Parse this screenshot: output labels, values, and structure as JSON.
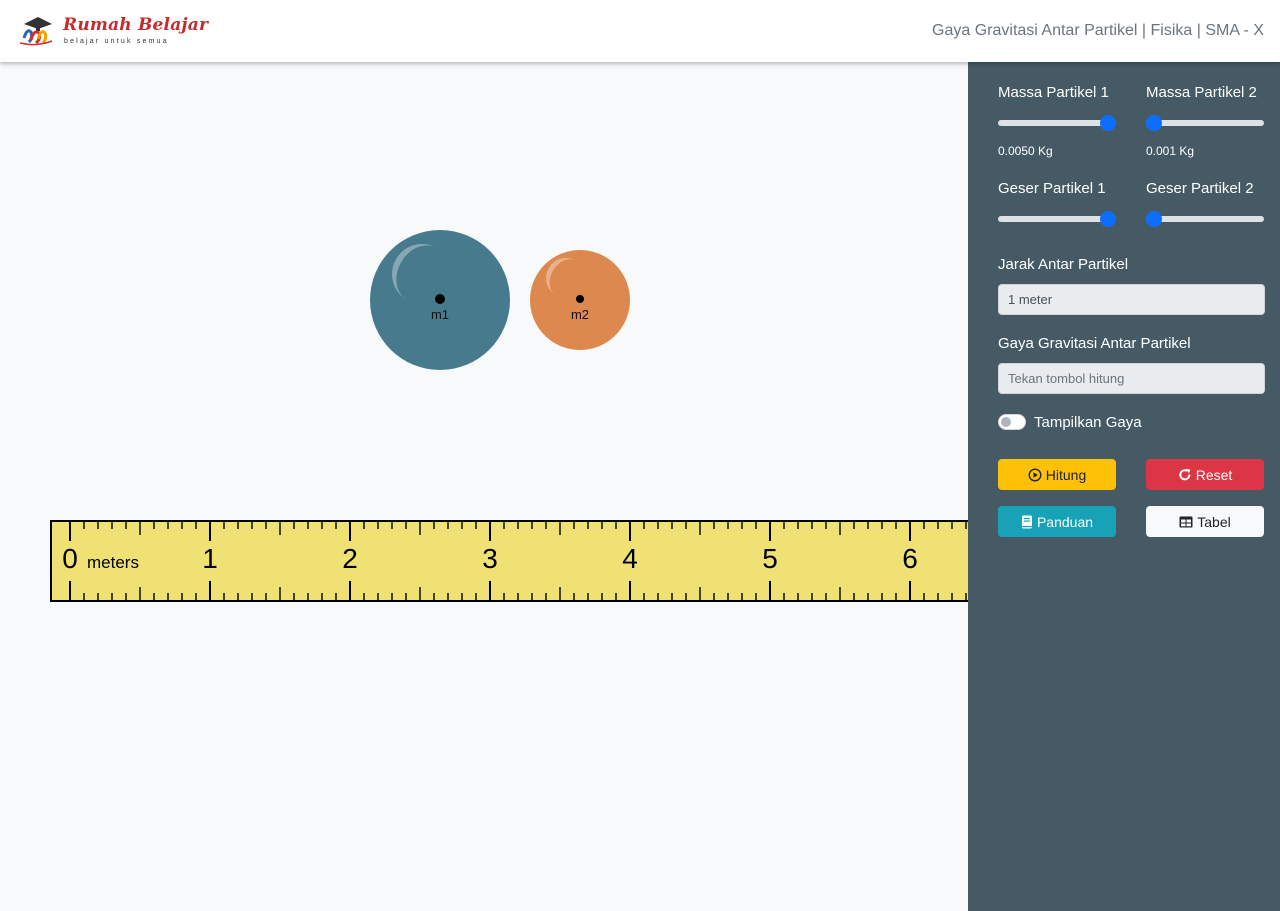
{
  "header": {
    "logo_title": "Rumah Belajar",
    "logo_subtitle": "belajar untuk semua",
    "page_title": "Gaya Gravitasi Antar Partikel | Fisika | SMA - X"
  },
  "stage": {
    "particle1_label": "m1",
    "particle2_label": "m2",
    "ruler": {
      "unit_label": "meters",
      "major_ticks": [
        "0",
        "1",
        "2",
        "3",
        "4",
        "5",
        "6"
      ]
    }
  },
  "panel": {
    "mass1": {
      "label": "Massa Partikel 1",
      "value_text": "0.0050 Kg",
      "slider_level": 1.0
    },
    "mass2": {
      "label": "Massa Partikel 2",
      "value_text": "0.001 Kg",
      "slider_level": 0.0
    },
    "shift1": {
      "label": "Geser Partikel 1",
      "slider_level": 1.0
    },
    "shift2": {
      "label": "Geser Partikel 2",
      "slider_level": 0.0
    },
    "distance": {
      "label": "Jarak Antar Partikel",
      "value": "1 meter"
    },
    "force": {
      "label": "Gaya Gravitasi Antar Partikel",
      "placeholder": "Tekan tombol hitung"
    },
    "show_force": {
      "label": "Tampilkan Gaya",
      "checked": false
    },
    "buttons": {
      "hitung": "Hitung",
      "reset": "Reset",
      "panduan": "Panduan",
      "tabel": "Tabel"
    }
  },
  "colors": {
    "panel_bg": "#455a64",
    "particle1": "#467a8c",
    "particle2": "#dd884e",
    "ruler_fill": "#efe174",
    "slider_thumb": "#0d6efd",
    "btn_hitung": "#ffc107",
    "btn_reset": "#dc3545",
    "btn_panduan": "#17a2b8"
  }
}
